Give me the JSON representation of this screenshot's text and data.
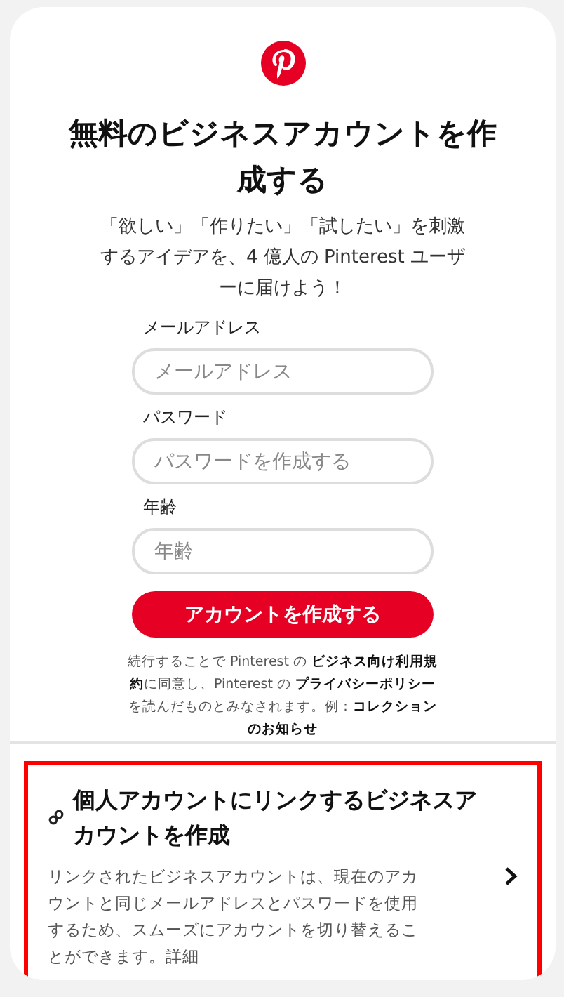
{
  "title": "無料のビジネスアカウントを作成する",
  "subtitle": "「欲しい」「作りたい」「試したい」を刺激するアイデアを、4 億人の Pinterest ユーザーに届けよう！",
  "fields": [
    {
      "label": "メールアドレス",
      "placeholder": "メールアドレス"
    },
    {
      "label": "パスワード",
      "placeholder": "パスワードを作成する"
    },
    {
      "label": "年齢",
      "placeholder": "年齢"
    }
  ],
  "submit_button": "アカウントを作成する",
  "terms": "続行することで Pinterest の **ビジネス向け利用規約**に同意し、Pinterest の **プライバシーポリシー**を読んだものとみなされます。例：**コレクションのお知らせ**",
  "linked_account": {
    "highlighted": true,
    "title": "個人アカウントにリンクするビジネスアカウントを作成",
    "description": "リンクされたビジネスアカウントは、現在のアカウントと同じメールアドレスとパスワードを使用するため、スムーズにアカウントを切り替えることができます。詳細"
  }
}
